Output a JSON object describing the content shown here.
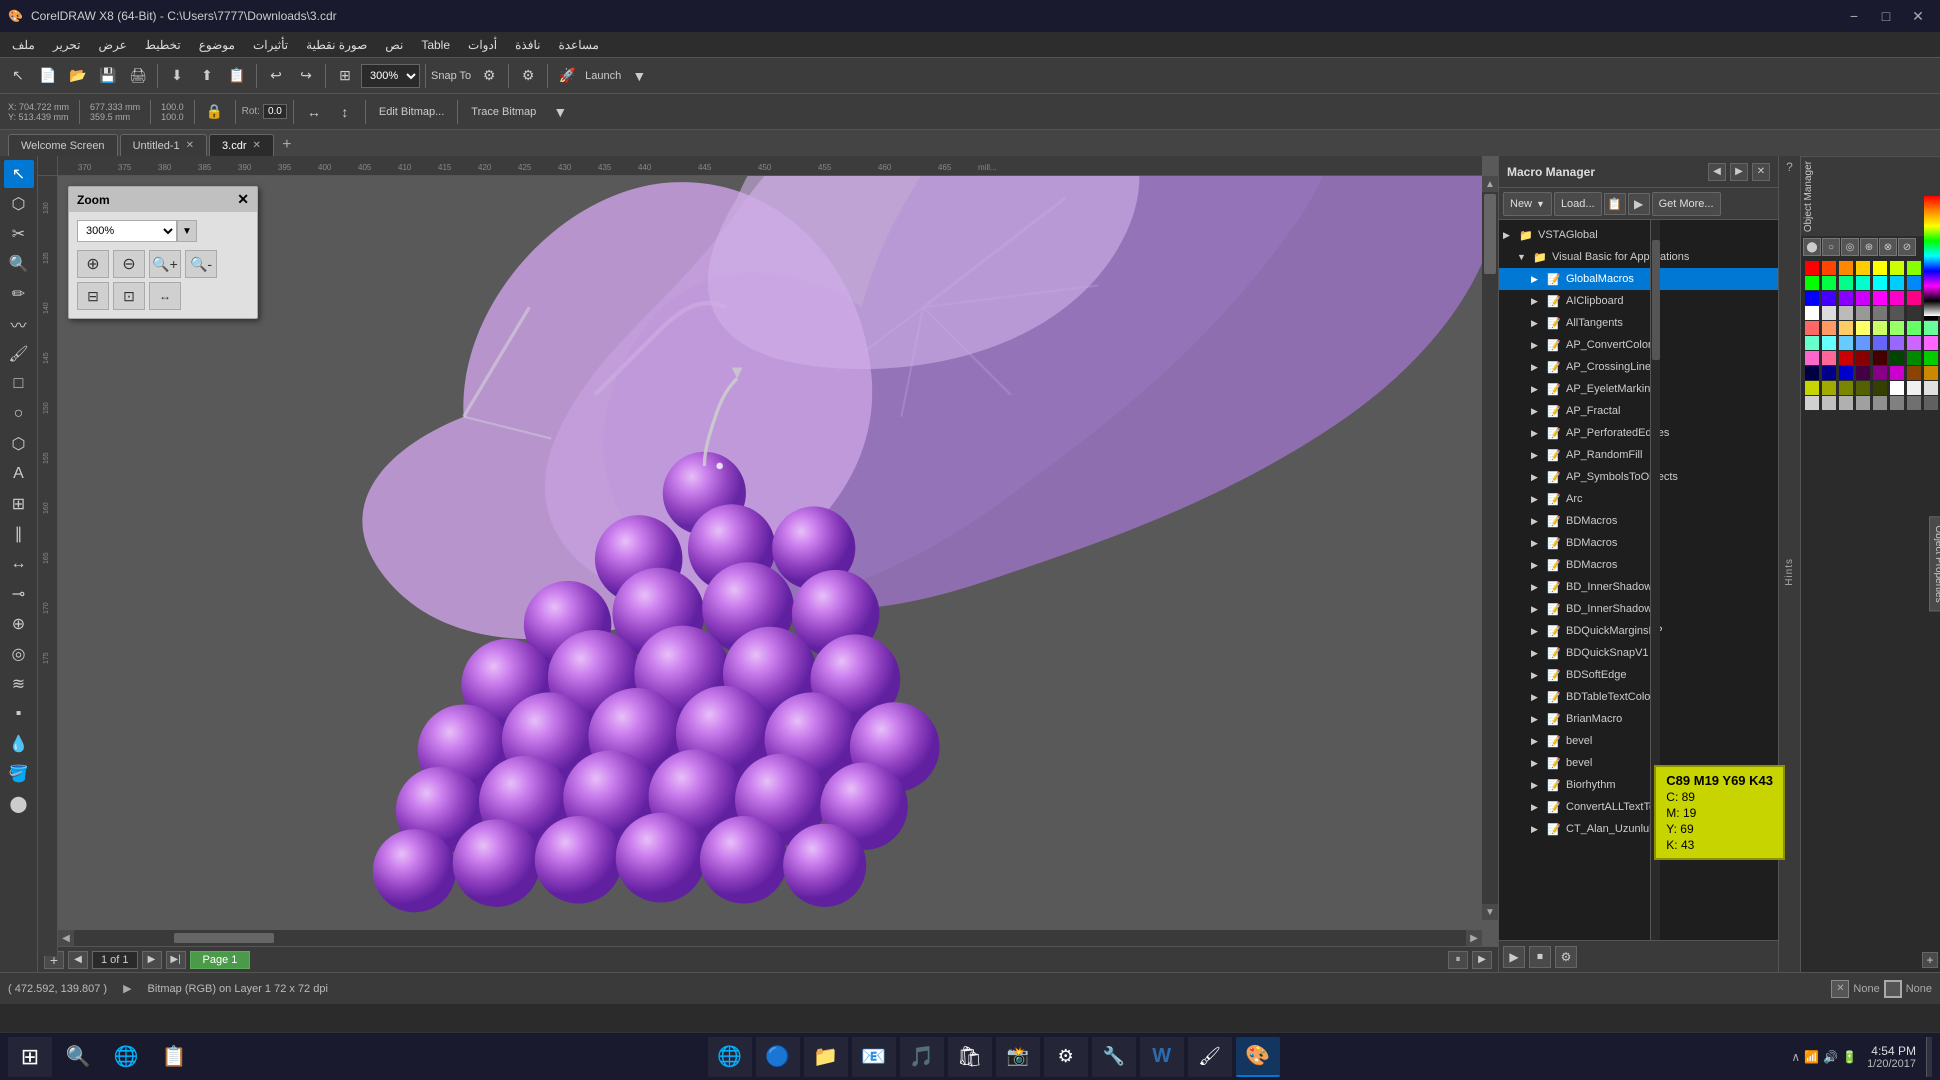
{
  "titlebar": {
    "title": "CorelDRAW X8 (64-Bit) - C:\\Users\\7777\\Downloads\\3.cdr",
    "logo": "🎨",
    "controls": [
      "−",
      "□",
      "✕"
    ]
  },
  "menubar": {
    "items": [
      "ملف",
      "تحرير",
      "عرض",
      "تخطيط",
      "موضوع",
      "تأثيرات",
      "صورة نقطية",
      "نص",
      "Table",
      "أدوات",
      "نافذة",
      "مساعدة"
    ]
  },
  "toolbar1": {
    "zoom_level": "300%",
    "snap_label": "Snap To",
    "launch_label": "Launch"
  },
  "toolbar2": {
    "x_label": "X:",
    "x_value": "704.722 mm",
    "y_label": "Y:",
    "y_value": "513.439 mm",
    "w_value": "677.333 mm",
    "h_value": "359.5 mm",
    "pct1": "100.0",
    "pct2": "100.0",
    "rotation": "0.0",
    "edit_bitmap_label": "Edit Bitmap...",
    "trace_bitmap_label": "Trace Bitmap"
  },
  "tabs": {
    "items": [
      "Welcome Screen",
      "Untitled-1",
      "3.cdr"
    ],
    "active": 2
  },
  "zoom_popup": {
    "title": "Zoom",
    "zoom_value": "300%",
    "buttons": [
      {
        "icon": "🔍+",
        "label": "zoom in"
      },
      {
        "icon": "🔍-",
        "label": "zoom out"
      },
      {
        "icon": "⊕",
        "label": "zoom in alt"
      },
      {
        "icon": "⊖",
        "label": "zoom out alt"
      },
      {
        "icon": "📄+",
        "label": "page zoom in"
      },
      {
        "icon": "📄-",
        "label": "page zoom out"
      },
      {
        "icon": "📄⊡",
        "label": "fit page"
      }
    ]
  },
  "canvas": {
    "ruler_unit": "millimeters",
    "page_label": "Page 1",
    "page_count": "1 of 1"
  },
  "macro_manager": {
    "title": "Macro Manager",
    "toolbar": {
      "new_label": "New",
      "load_label": "Load...",
      "get_more_label": "Get More..."
    },
    "tree": [
      {
        "id": "vsta",
        "level": 0,
        "label": "VSTAGlobal",
        "icon": "📁",
        "expanded": true
      },
      {
        "id": "vba",
        "level": 1,
        "label": "Visual Basic for Applications",
        "icon": "📁",
        "expanded": true
      },
      {
        "id": "global",
        "level": 2,
        "label": "GlobalMacros",
        "icon": "📝",
        "selected": true
      },
      {
        "id": "aicb",
        "level": 2,
        "label": "AIClipboard",
        "icon": "📝"
      },
      {
        "id": "alltang",
        "level": 2,
        "label": "AllTangents",
        "icon": "📝"
      },
      {
        "id": "apconv",
        "level": 2,
        "label": "AP_ConvertColors",
        "icon": "📝"
      },
      {
        "id": "apcross",
        "level": 2,
        "label": "AP_CrossingLines",
        "icon": "📝"
      },
      {
        "id": "apeyelet",
        "level": 2,
        "label": "AP_EyeletMarking",
        "icon": "📝"
      },
      {
        "id": "apfractal",
        "level": 2,
        "label": "AP_Fractal",
        "icon": "📝"
      },
      {
        "id": "apperf",
        "level": 2,
        "label": "AP_PerforatedEdges",
        "icon": "📝"
      },
      {
        "id": "aprand",
        "level": 2,
        "label": "AP_RandomFill",
        "icon": "📝"
      },
      {
        "id": "apsym",
        "level": 2,
        "label": "AP_SymbolsToObjects",
        "icon": "📝"
      },
      {
        "id": "aparc",
        "level": 2,
        "label": "Arc",
        "icon": "📝"
      },
      {
        "id": "bdmac1",
        "level": 2,
        "label": "BDMacros",
        "icon": "📝"
      },
      {
        "id": "bdmac2",
        "level": 2,
        "label": "BDMacros",
        "icon": "📝"
      },
      {
        "id": "bdmac3",
        "level": 2,
        "label": "BDMacros",
        "icon": "📝"
      },
      {
        "id": "bdinner1",
        "level": 2,
        "label": "BD_InnerShadow",
        "icon": "📝"
      },
      {
        "id": "bdinner2",
        "level": 2,
        "label": "BD_InnerShadow",
        "icon": "📝"
      },
      {
        "id": "bdquick",
        "level": 2,
        "label": "BDQuickMarginsFP",
        "icon": "📝"
      },
      {
        "id": "bdsnap",
        "level": 2,
        "label": "BDQuickSnapV1",
        "icon": "📝"
      },
      {
        "id": "bdsoft",
        "level": 2,
        "label": "BDSoftEdge",
        "icon": "📝"
      },
      {
        "id": "bdtable",
        "level": 2,
        "label": "BDTableTextColour",
        "icon": "📝"
      },
      {
        "id": "brian",
        "level": 2,
        "label": "BrianMacro",
        "icon": "📝"
      },
      {
        "id": "bevel1",
        "level": 2,
        "label": "bevel",
        "icon": "📝"
      },
      {
        "id": "bevel2",
        "level": 2,
        "label": "bevel",
        "icon": "📝"
      },
      {
        "id": "biorhythm",
        "level": 2,
        "label": "Biorhythm",
        "icon": "📝"
      },
      {
        "id": "convertall",
        "level": 2,
        "label": "ConvertALLTextToCurves",
        "icon": "📝"
      },
      {
        "id": "ct_alan",
        "level": 2,
        "label": "CT_Alan_Uzunluk_Hesaplaycs",
        "icon": "📝"
      }
    ]
  },
  "color_tooltip": {
    "title": "C89 M19 Y69 K43",
    "c": "C: 89",
    "m": "M: 19",
    "y": "Y: 69",
    "k": "K: 43"
  },
  "statusbar": {
    "coords": "( 472.592, 139.807 )",
    "description": "Bitmap (RGB) on Layer 1 72 x 72 dpi",
    "fill_label": "None",
    "stroke_label": "None"
  },
  "page_nav": {
    "page_info": "1 of 1",
    "page_name": "Page 1"
  },
  "taskbar": {
    "time": "4:54 PM",
    "date": "1/20/2017",
    "apps": [
      "⊞",
      "🔍",
      "🌐",
      "📁",
      "🌐",
      "📧",
      "📂",
      "♪",
      "🎨",
      "📝",
      "🔧",
      "⚙",
      "🟢"
    ]
  },
  "colors": {
    "swatches": [
      "#ff0000",
      "#ff4400",
      "#ff8800",
      "#ffcc00",
      "#ffff00",
      "#ccff00",
      "#88ff00",
      "#44ff00",
      "#00ff00",
      "#00ff44",
      "#00ff88",
      "#00ffcc",
      "#00ffff",
      "#00ccff",
      "#0088ff",
      "#0044ff",
      "#0000ff",
      "#4400ff",
      "#8800ff",
      "#cc00ff",
      "#ff00ff",
      "#ff00cc",
      "#ff0088",
      "#ff0044",
      "#ffffff",
      "#dddddd",
      "#bbbbbb",
      "#999999",
      "#777777",
      "#555555",
      "#333333",
      "#000000",
      "#ff6666",
      "#ff9966",
      "#ffcc66",
      "#ffff66",
      "#ccff66",
      "#99ff66",
      "#66ff66",
      "#66ff99",
      "#66ffcc",
      "#66ffff",
      "#66ccff",
      "#6699ff",
      "#6666ff",
      "#9966ff",
      "#cc66ff",
      "#ff66ff",
      "#ff66cc",
      "#ff6699",
      "#cc0000",
      "#880000",
      "#440000",
      "#004400",
      "#008800",
      "#00cc00",
      "#000044",
      "#000088",
      "#0000cc",
      "#440044",
      "#880088",
      "#cc00cc",
      "#884400",
      "#cc8800",
      "#c8d400",
      "#a0aa00",
      "#7a8500",
      "#556000",
      "#354000",
      "#ffffff",
      "#f0f0f0",
      "#e0e0e0",
      "#d0d0d0",
      "#c0c0c0",
      "#b0b0b0",
      "#a0a0a0",
      "#909090",
      "#808080",
      "#707070",
      "#606060"
    ]
  }
}
